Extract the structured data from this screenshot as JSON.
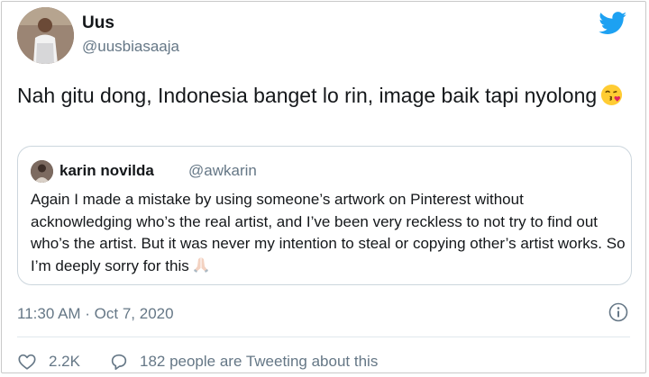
{
  "tweet": {
    "author_name": "Uus",
    "author_handle": "@uusbiasaaja",
    "text": "Nah gitu dong, Indonesia banget lo rin, image baik tapi nyolong",
    "emoji": "face-blowing-kiss",
    "timestamp": "11:30 AM · Oct 7, 2020"
  },
  "quoted_tweet": {
    "author_name": "karin novilda",
    "author_handle": "@awkarin",
    "text": "Again I made a mistake by using someone’s artwork on Pinterest without acknowledging who’s the real artist, and I’ve been very reckless to not try to find out who’s the artist. But it was never my intention to steal or copying other’s artist works. So I’m deeply sorry for this",
    "emoji": "folded-hands"
  },
  "actions": {
    "like_count": "2.2K",
    "reply_text": "182 people are Tweeting about this"
  },
  "colors": {
    "twitter_blue": "#1da1f2",
    "secondary_text": "#657786",
    "primary_text": "#14171a",
    "border": "#ccd6dd"
  },
  "icons": [
    "twitter-bird-icon",
    "info-icon",
    "heart-icon",
    "speech-bubble-icon"
  ]
}
